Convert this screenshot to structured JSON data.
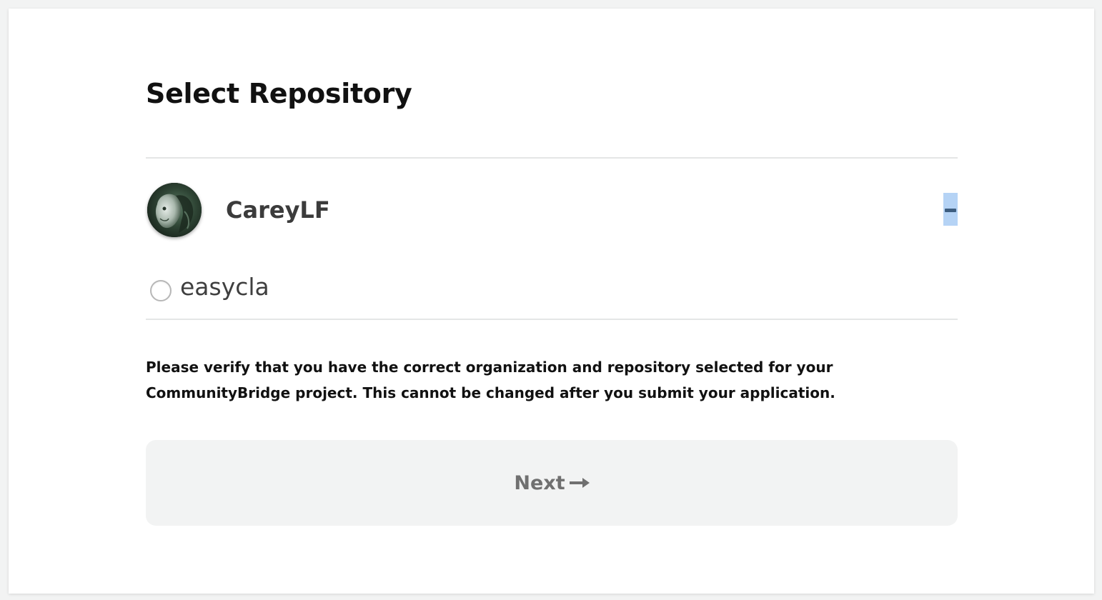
{
  "page": {
    "title": "Select Repository"
  },
  "organization": {
    "name": "CareyLF",
    "avatar_icon": "user-avatar",
    "toggle_icon": "collapse-minus-icon",
    "expanded": true
  },
  "repositories": [
    {
      "name": "easycla",
      "selected": false
    }
  ],
  "notice": {
    "text": "Please verify that you have the correct organization and repository selected for your CommunityBridge project. This cannot be changed after you submit your application."
  },
  "next_button": {
    "label": "Next",
    "icon": "arrow-right-icon",
    "enabled": false
  },
  "colors": {
    "background": "#f2f3f3",
    "card": "#ffffff",
    "toggle_highlight": "#b5d3f5",
    "button_bg": "#f2f3f3",
    "button_text": "#707070"
  }
}
